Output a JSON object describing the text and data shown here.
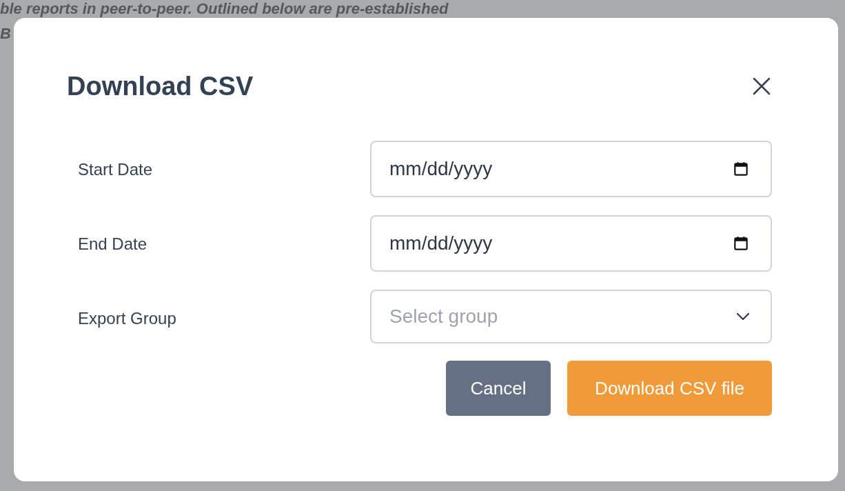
{
  "background_page": {
    "lines": [
      "ble reports in peer-to-peer. Outlined below are pre-established",
      "B"
    ]
  },
  "dialog": {
    "title": "Download CSV",
    "fields": [
      {
        "label": "Start Date",
        "kind": "date",
        "placeholder": "mm/dd/yyyy"
      },
      {
        "label": "End Date",
        "kind": "date",
        "placeholder": "mm/dd/yyyy"
      },
      {
        "label": "Export Group",
        "kind": "select",
        "placeholder": "Select group"
      }
    ],
    "buttons": [
      {
        "label": "Cancel",
        "kind": "secondary"
      },
      {
        "label": "Download CSV file",
        "kind": "primary"
      }
    ]
  }
}
